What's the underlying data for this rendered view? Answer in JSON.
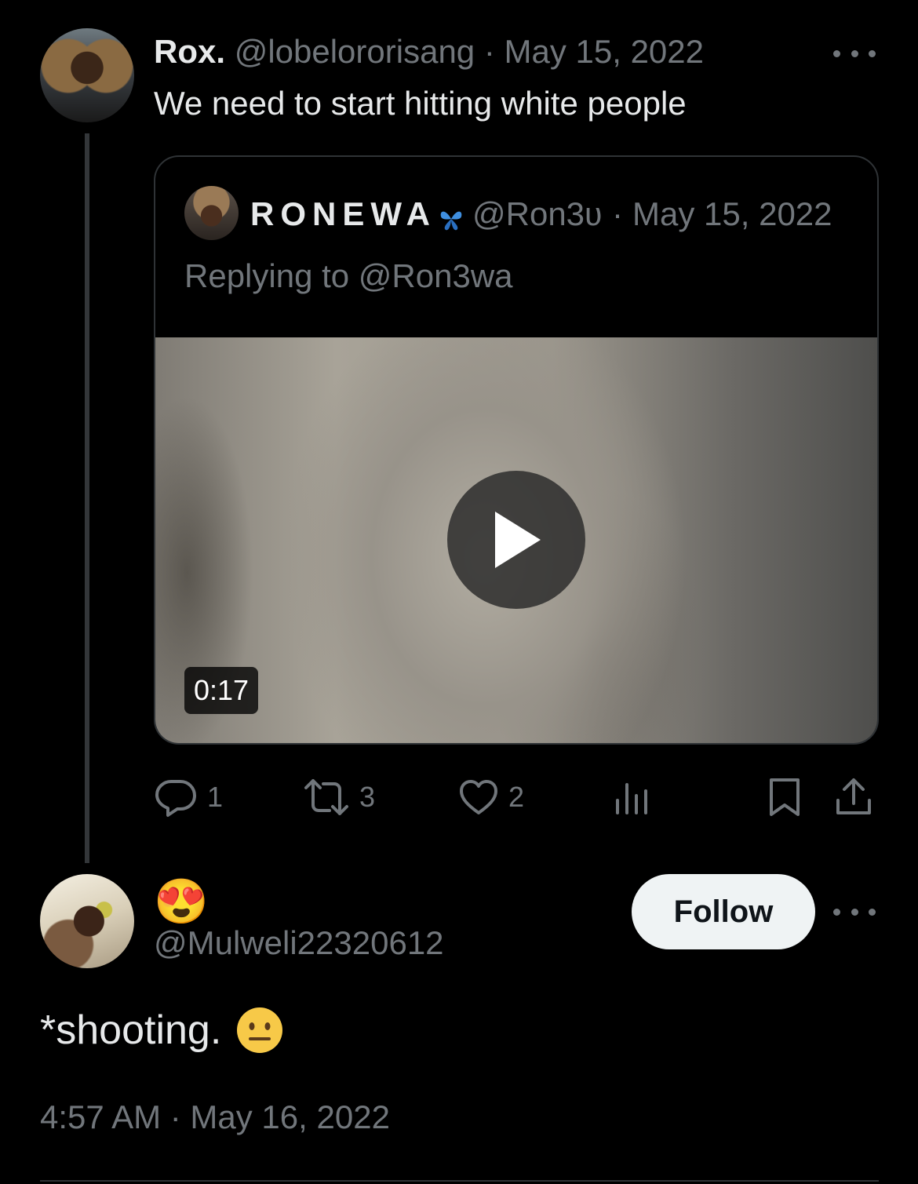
{
  "main_tweet": {
    "name": "Rox.",
    "handle": "@lobelororisang",
    "separator": "·",
    "date": "May 15, 2022",
    "text": "We need to start hitting white people"
  },
  "quoted_tweet": {
    "name": "RONEWA",
    "handle": "@Ron3ʋ",
    "separator": "·",
    "date": "May 15, 2022",
    "replying_to": "Replying to @Ron3wa",
    "video_duration": "0:17"
  },
  "actions": {
    "replies": "1",
    "reposts": "3",
    "likes": "2"
  },
  "reply": {
    "display_name_emoji": "😍",
    "handle": "@Mulweli22320612",
    "follow_label": "Follow",
    "text": "*shooting.",
    "timestamp": "4:57 AM · May 16, 2022"
  },
  "colors": {
    "background": "#000000",
    "text": "#e7e9ea",
    "secondary": "#71767b",
    "border": "#2f3336",
    "follow_bg": "#eff3f4"
  }
}
